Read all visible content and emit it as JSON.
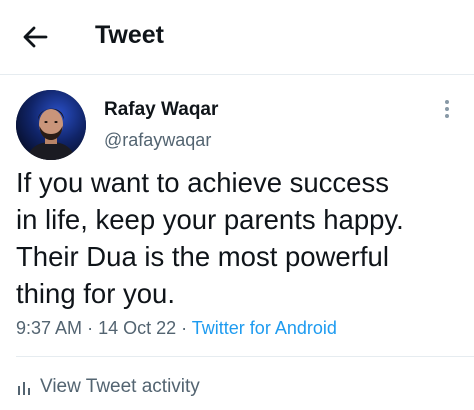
{
  "header": {
    "title": "Tweet",
    "back_icon": "arrow-left-icon"
  },
  "author": {
    "display_name": "Rafay Waqar",
    "handle": "@rafaywaqar"
  },
  "tweet": {
    "text": "If you want to achieve success\nin life, keep your parents happy.\nTheir Dua is the most powerful\nthing for you.",
    "time": "9:37 AM",
    "date": "14 Oct 22",
    "source": "Twitter for Android"
  },
  "activity": {
    "label": "View Tweet activity",
    "icon": "bar-chart-icon"
  },
  "colors": {
    "link": "#1d9bf0",
    "secondary_text": "#536471",
    "primary_text": "#0f1419",
    "divider": "#e6ecf0"
  }
}
